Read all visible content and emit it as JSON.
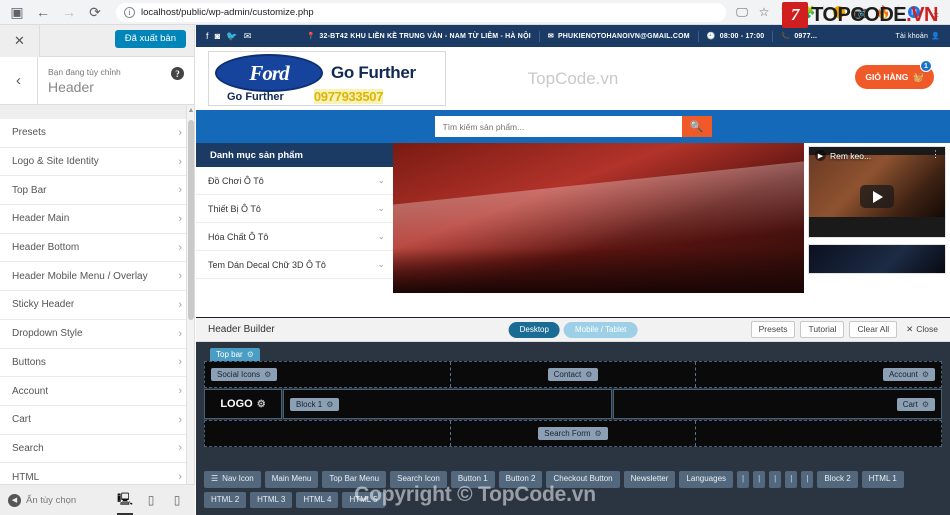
{
  "browser": {
    "url": "localhost/public/wp-admin/customize.php",
    "icons": {
      "tab_search": "tab-search-icon",
      "back": "back-arrow-icon",
      "forward": "forward-arrow-icon",
      "reload": "reload-icon",
      "info": "info-icon",
      "cast": "cast-icon",
      "bookmark": "star-icon",
      "shield": "shield-icon",
      "extension": "extension-icon",
      "profile": "profile-avatar-icon",
      "download": "download-icon"
    }
  },
  "watermark": {
    "badge": "7",
    "brand": "TOPCODE",
    "brand_tld": ".VN",
    "copyright": "Copyright © TopCode.vn"
  },
  "customizer": {
    "close_label": "✕",
    "publish_label": "Đã xuất bản",
    "back_label": "‹",
    "breadcrumb": "Bạn đang tùy chỉnh",
    "title": "Header",
    "help_label": "?",
    "items": [
      {
        "label": "Presets"
      },
      {
        "label": "Logo & Site Identity"
      },
      {
        "label": "Top Bar"
      },
      {
        "label": "Header Main"
      },
      {
        "label": "Header Bottom"
      },
      {
        "label": "Header Mobile Menu / Overlay"
      },
      {
        "label": "Sticky Header"
      },
      {
        "label": "Dropdown Style"
      },
      {
        "label": "Buttons"
      },
      {
        "label": "Account"
      },
      {
        "label": "Cart"
      },
      {
        "label": "Search"
      },
      {
        "label": "HTML"
      }
    ],
    "footer": {
      "hide_label": "Ẩn tùy chọn",
      "devices": [
        {
          "name": "desktop",
          "glyph": "🖳",
          "active": true
        },
        {
          "name": "tablet",
          "glyph": "▯",
          "active": false
        },
        {
          "name": "mobile",
          "glyph": "▯",
          "active": false
        }
      ]
    }
  },
  "site": {
    "topbar": {
      "social": [
        "f",
        "◎",
        "🐦",
        "✉"
      ],
      "address": "32-BT42 KHU LIỀN KỀ TRUNG VĂN - NAM TỪ LIÊM - HÀ NỘI",
      "email": "PHUKIENOTOHANOIVN@GMAIL.COM",
      "hours": "08:00 - 17:00",
      "phone": "0977...",
      "account": "Tài khoản"
    },
    "logo": {
      "brand": "Ford",
      "tagline_big": "Go Further",
      "tagline_small": "Go Further",
      "phone": "0977933507"
    },
    "brandmark": "TopCode.vn",
    "cart": {
      "label": "GIỎ HÀNG",
      "count": "1",
      "icon": "basket-icon"
    },
    "search": {
      "placeholder": "Tìm kiếm sản phẩm...",
      "button_icon": "search-icon"
    },
    "categories": {
      "heading": "Danh mục sản phẩm",
      "items": [
        {
          "label": "Đồ Chơi Ô Tô"
        },
        {
          "label": "Thiết Bị Ô Tô"
        },
        {
          "label": "Hóa Chất Ô Tô"
        },
        {
          "label": "Tem Dán Decal Chữ 3D Ô Tô"
        }
      ]
    },
    "video": {
      "title": "Rem keo...",
      "play_icon": "play-icon",
      "menu_icon": "kebab-menu-icon"
    }
  },
  "header_builder": {
    "title": "Header Builder",
    "devices": [
      {
        "label": "Desktop",
        "active": true
      },
      {
        "label": "Mobile / Tablet",
        "active": false
      }
    ],
    "actions": [
      {
        "label": "Presets"
      },
      {
        "label": "Tutorial"
      },
      {
        "label": "Clear All"
      }
    ],
    "close_label": "Close",
    "rows": [
      {
        "tab": "Top bar",
        "cells": [
          {
            "align": "left",
            "items": [
              "Social Icons"
            ]
          },
          {
            "align": "center",
            "items": [
              "Contact"
            ]
          },
          {
            "align": "right",
            "items": [
              "Account"
            ]
          }
        ]
      },
      {
        "tab": "",
        "cells": [
          {
            "align": "left",
            "items": [
              "LOGO",
              "Block 1"
            ]
          },
          {
            "align": "right",
            "items": [
              "Cart"
            ]
          }
        ]
      },
      {
        "tab": "",
        "cells": [
          {
            "align": "left",
            "items": []
          },
          {
            "align": "center",
            "items": [
              "Search Form"
            ]
          },
          {
            "align": "right",
            "items": []
          }
        ]
      }
    ],
    "palette": [
      {
        "label": "Nav Icon",
        "icon": "hamburger-icon"
      },
      {
        "label": "Main Menu"
      },
      {
        "label": "Top Bar Menu"
      },
      {
        "label": "Search Icon"
      },
      {
        "label": "Button 1"
      },
      {
        "label": "Button 2"
      },
      {
        "label": "Checkout Button"
      },
      {
        "label": "Newsletter"
      },
      {
        "label": "Languages"
      },
      {
        "label": "|",
        "divider": true
      },
      {
        "label": "|",
        "divider": true
      },
      {
        "label": "|",
        "divider": true
      },
      {
        "label": "|",
        "divider": true
      },
      {
        "label": "|",
        "divider": true
      },
      {
        "label": "Block 2"
      },
      {
        "label": "HTML 1"
      },
      {
        "label": "HTML 2"
      },
      {
        "label": "HTML 3"
      },
      {
        "label": "HTML 4"
      },
      {
        "label": "HTML 5"
      }
    ]
  }
}
